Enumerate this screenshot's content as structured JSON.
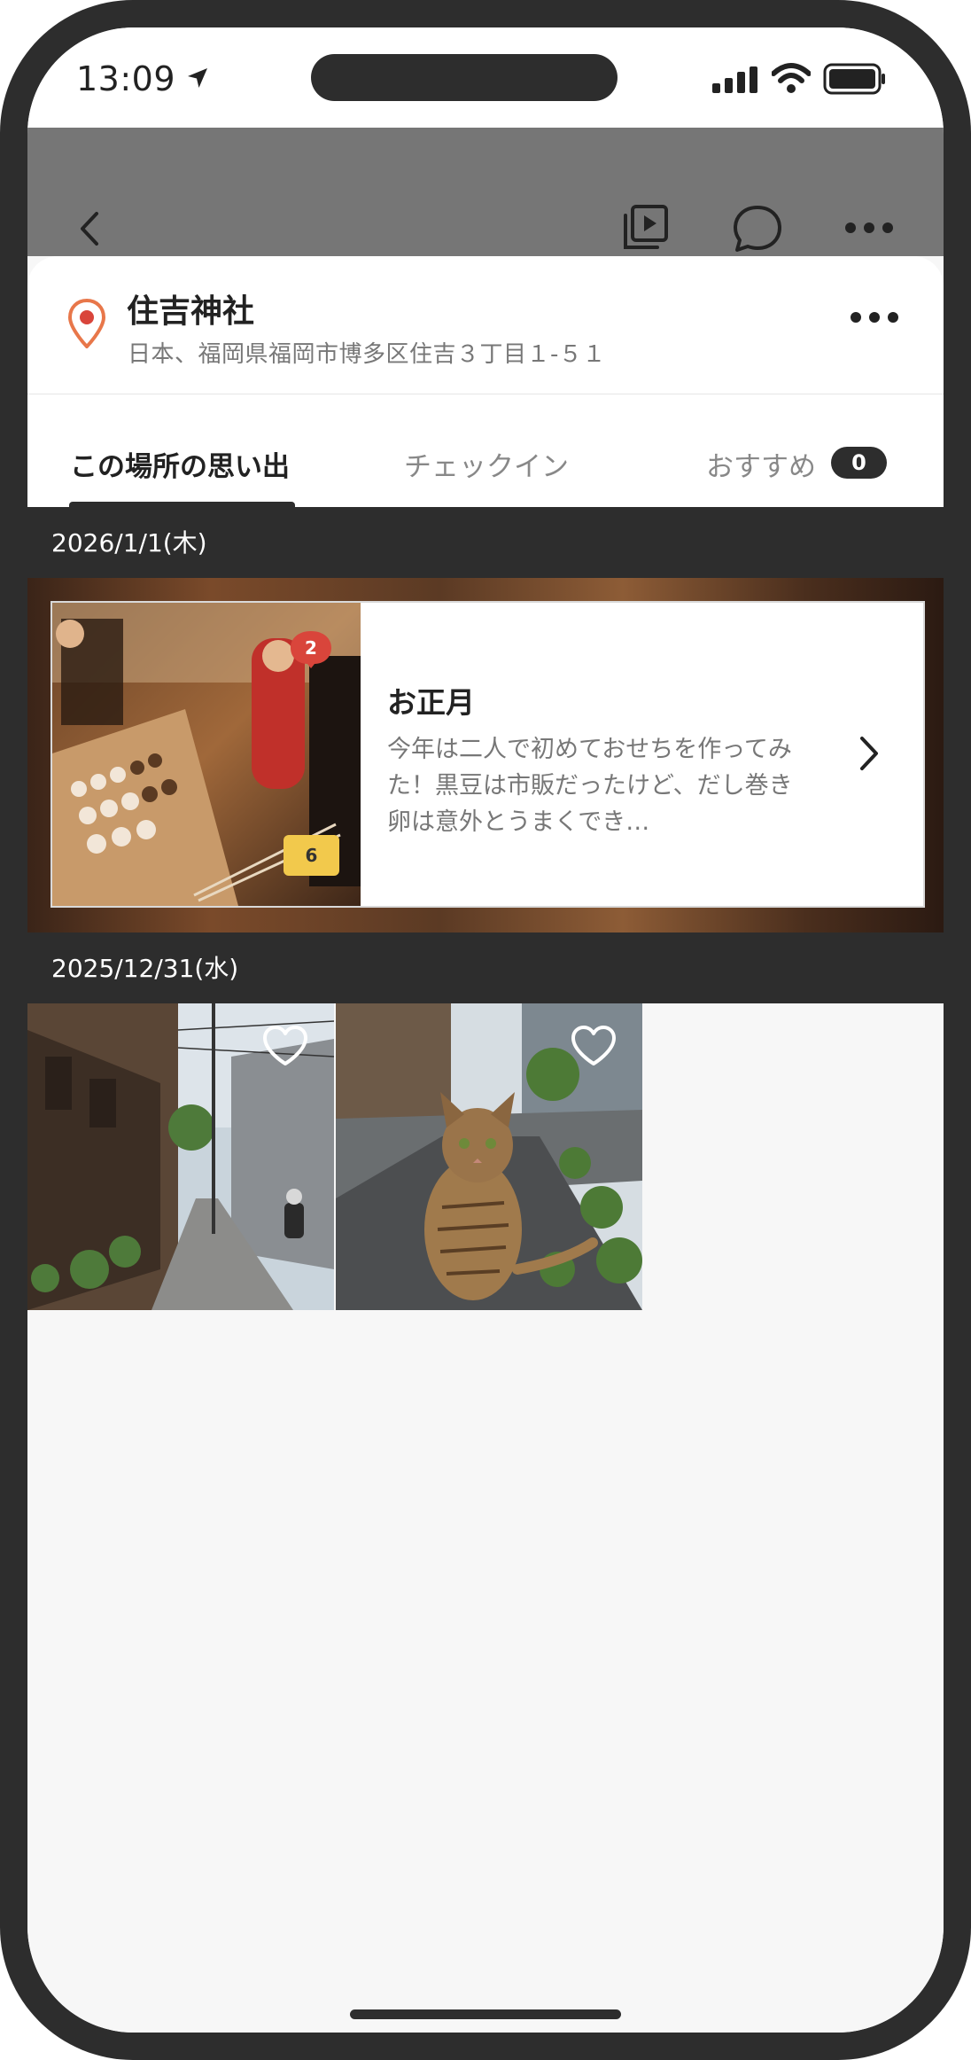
{
  "status_bar": {
    "time": "13:09"
  },
  "place": {
    "name": "住吉神社",
    "address": "日本、福岡県福岡市博多区住吉３丁目１-５１"
  },
  "tabs": [
    {
      "label": "この場所の思い出",
      "active": true
    },
    {
      "label": "チェックイン",
      "active": false
    },
    {
      "label": "おすすめ",
      "active": false,
      "badge": "0"
    }
  ],
  "sections": [
    {
      "date": "2026/1/1(木)",
      "memory": {
        "title": "お正月",
        "body": "今年は二人で初めておせちを作ってみた！黒豆は市販だったけど、だし巻き卵は意外とうまくでき…",
        "comment_count": "2",
        "photo_count": "6"
      }
    },
    {
      "date": "2025/12/31(水)",
      "photos": [
        {
          "icon": "heart-outline-icon",
          "subject": "street"
        },
        {
          "icon": "heart-outline-icon",
          "subject": "cat"
        }
      ]
    }
  ],
  "colors": {
    "dark": "#2d2d2d",
    "nav_gray": "#767676",
    "pin_orange": "#e8774a",
    "badge_red": "#d9453b",
    "badge_yellow": "#f2c94c"
  }
}
